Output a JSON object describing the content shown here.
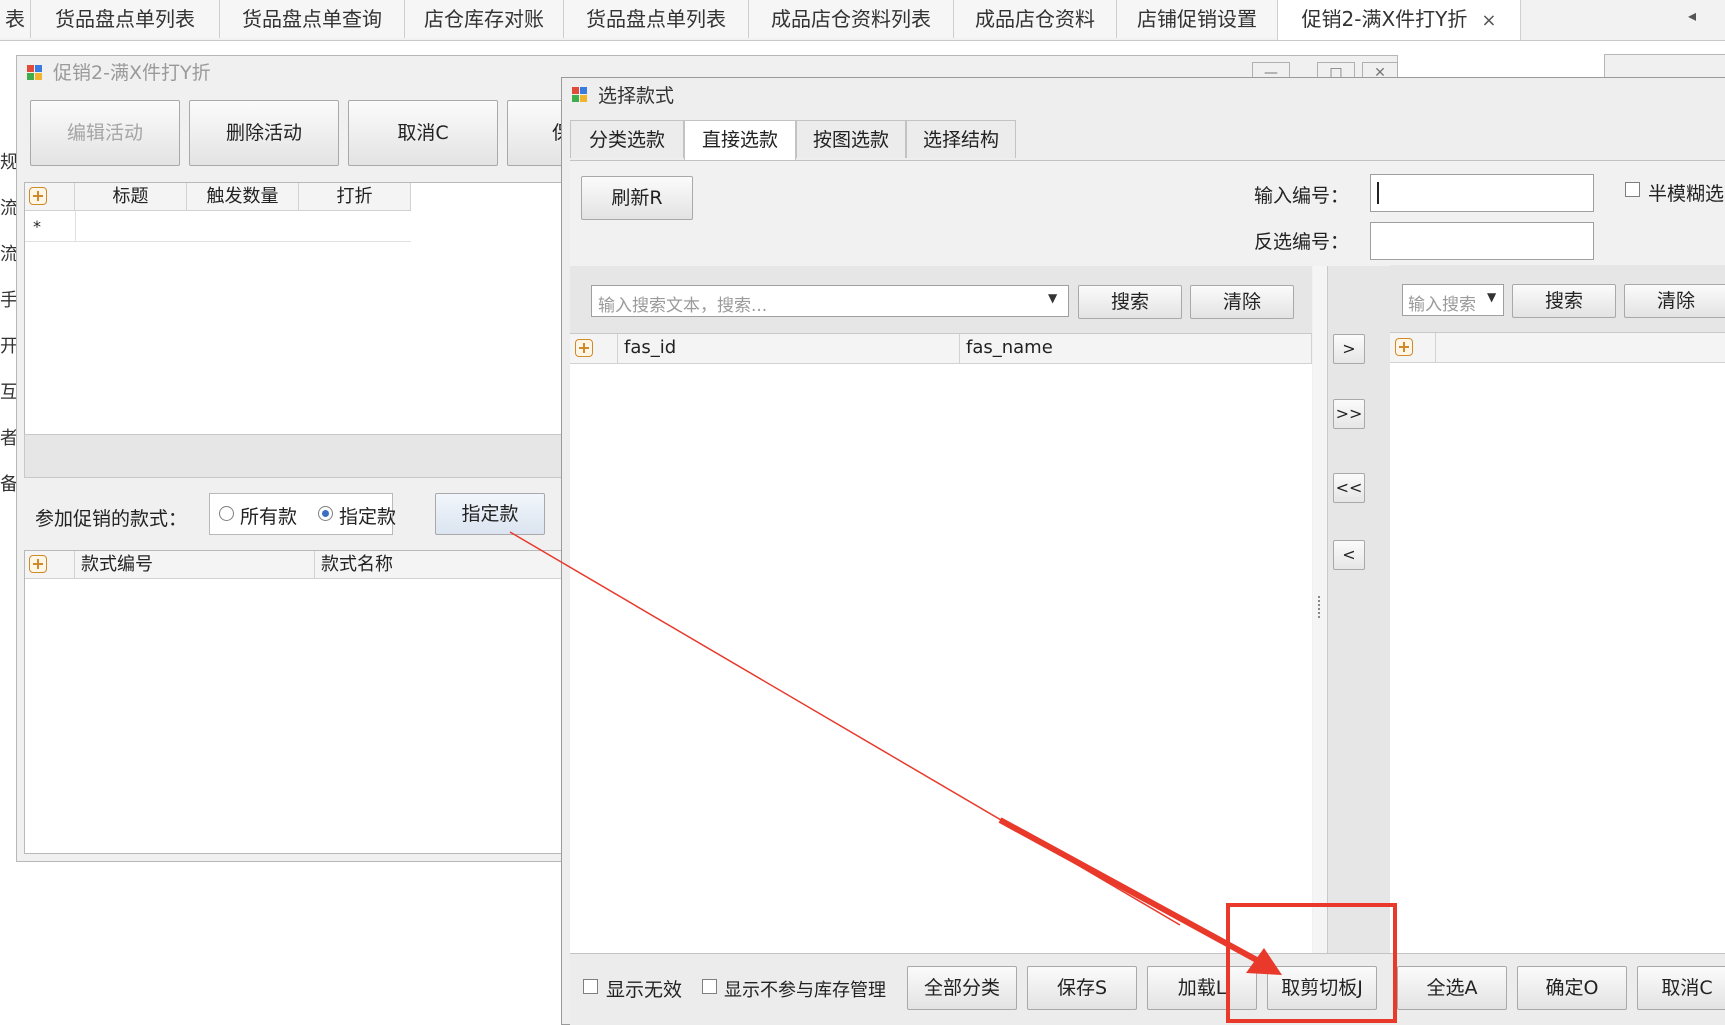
{
  "top_tabs": [
    {
      "label": "表"
    },
    {
      "label": "货品盘点单列表"
    },
    {
      "label": "货品盘点单查询"
    },
    {
      "label": "店仓库存对账"
    },
    {
      "label": "货品盘点单列表"
    },
    {
      "label": "成品店仓资料列表"
    },
    {
      "label": "成品店仓资料"
    },
    {
      "label": "店铺促销设置"
    },
    {
      "label": "促销2-满X件打Y折",
      "active": true
    }
  ],
  "tab_close": "×",
  "tab_scroll": "◂",
  "back_window": {
    "title": "促销2-满X件打Y折",
    "window_controls": [
      "—",
      "□",
      "✕"
    ],
    "toolbar": {
      "edit": "编辑活动",
      "delete": "删除活动",
      "cancel": "取消C",
      "more": "保"
    },
    "grid1_headers": [
      "标题",
      "触发数量",
      "打折"
    ],
    "new_row_marker": "*",
    "styles_label": "参加促销的款式：",
    "radio_all": "所有款",
    "radio_specified": "指定款",
    "specify_button": "指定款",
    "grid2_headers": [
      "款式编号",
      "款式名称"
    ],
    "left_cut_letters": [
      "规",
      "流",
      "流",
      "手",
      "开",
      "互",
      "者",
      "备"
    ]
  },
  "dialog": {
    "title": "选择款式",
    "tabs": [
      {
        "label": "分类选款"
      },
      {
        "label": "直接选款",
        "active": true
      },
      {
        "label": "按图选款"
      },
      {
        "label": "选择结构"
      }
    ],
    "refresh": "刷新R",
    "input_code_label": "输入编号：",
    "reverse_code_label": "反选编号：",
    "fuzzy_label": "半模糊选",
    "search_placeholder": "输入搜索文本，搜索...",
    "search_button": "搜索",
    "clear_button": "清除",
    "right_search_placeholder": "输入搜索",
    "right_search_button": "搜索",
    "right_clear_button": "清除",
    "left_grid_headers": [
      "fas_id",
      "fas_name"
    ],
    "transfer": [
      ">",
      ">>",
      "<<",
      "<"
    ],
    "bottom": {
      "show_invalid": "显示无效",
      "show_not_stock": "显示不参与库存管理",
      "all_categories": "全部分类",
      "save": "保存S",
      "load": "加载L",
      "clipboard": "取剪切板J",
      "select_all": "全选A",
      "ok": "确定O",
      "cancel": "取消C"
    }
  },
  "annotation_color": "#e8392b"
}
